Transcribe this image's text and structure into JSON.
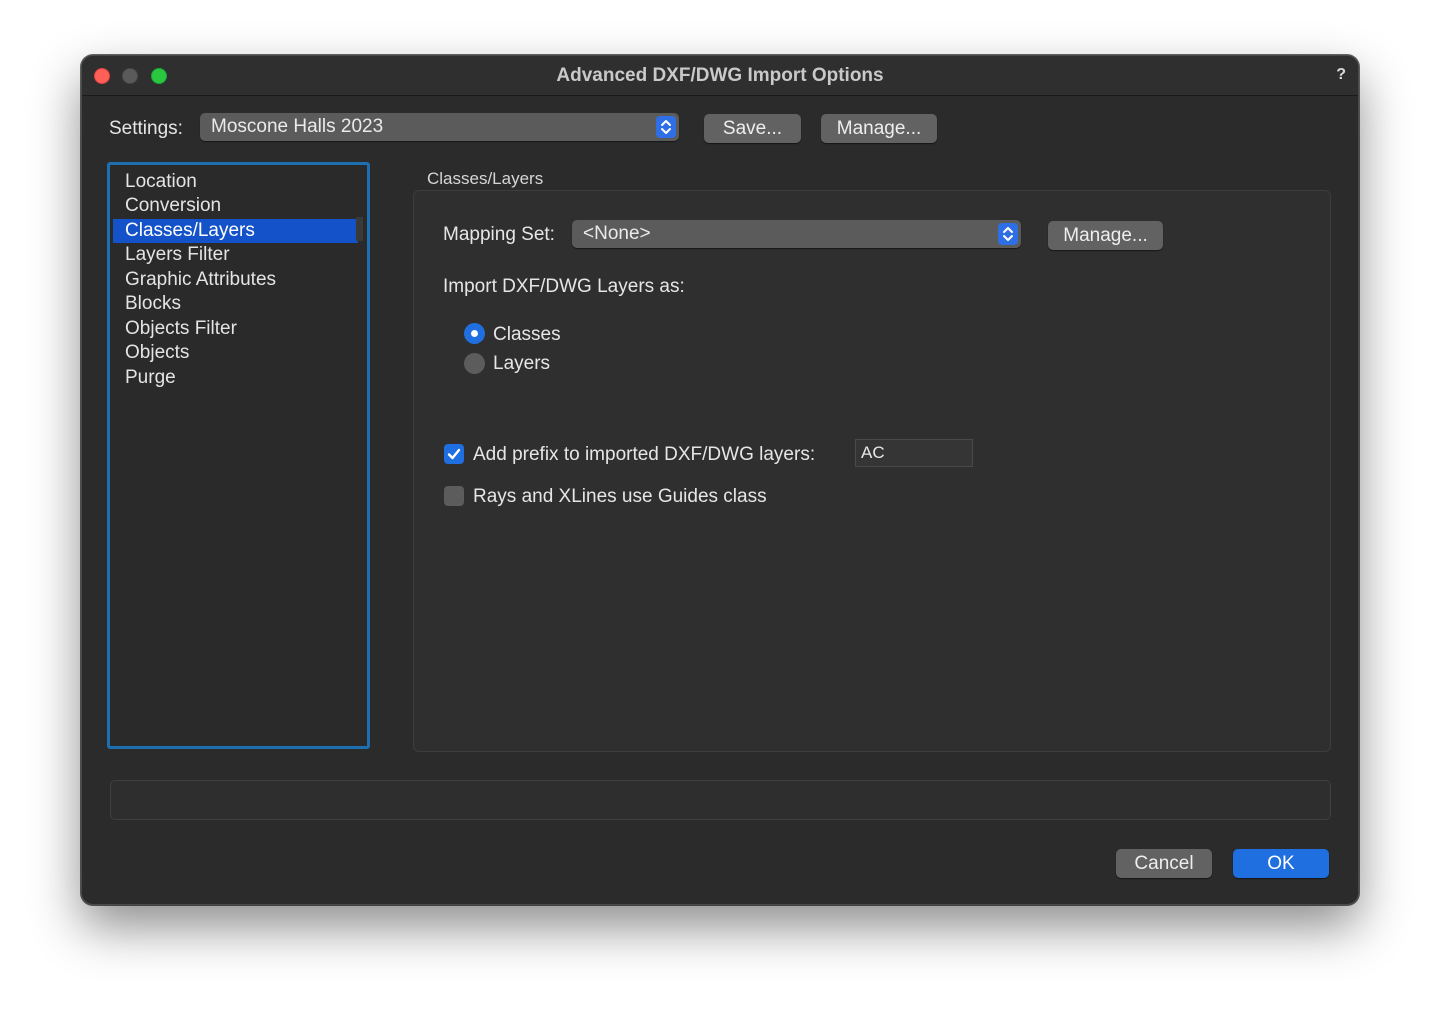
{
  "window": {
    "title": "Advanced DXF/DWG Import Options",
    "help_label": "?"
  },
  "settings": {
    "label": "Settings:",
    "selected": "Moscone Halls 2023",
    "save_label": "Save...",
    "manage_label": "Manage..."
  },
  "sidebar": {
    "items": [
      {
        "label": "Location"
      },
      {
        "label": "Conversion"
      },
      {
        "label": "Classes/Layers",
        "selected": true
      },
      {
        "label": "Layers Filter"
      },
      {
        "label": "Graphic Attributes"
      },
      {
        "label": "Blocks"
      },
      {
        "label": "Objects Filter"
      },
      {
        "label": "Objects"
      },
      {
        "label": "Purge"
      }
    ]
  },
  "panel": {
    "title": "Classes/Layers",
    "mapping_label": "Mapping Set:",
    "mapping_selected": "<None>",
    "mapping_manage_label": "Manage...",
    "import_as_label": "Import DXF/DWG Layers as:",
    "radio_options": [
      {
        "label": "Classes",
        "selected": true
      },
      {
        "label": "Layers",
        "selected": false
      }
    ],
    "prefix_checkbox": {
      "label": "Add prefix to imported DXF/DWG layers:",
      "checked": true
    },
    "prefix_value": "AC",
    "guides_checkbox": {
      "label": "Rays and XLines use Guides class",
      "checked": false
    }
  },
  "footer": {
    "cancel_label": "Cancel",
    "ok_label": "OK"
  },
  "colors": {
    "accent": "#1f6fe0",
    "selection": "#1452c9",
    "focus_ring": "#1d6fb1",
    "window_bg": "#2b2b2b"
  }
}
